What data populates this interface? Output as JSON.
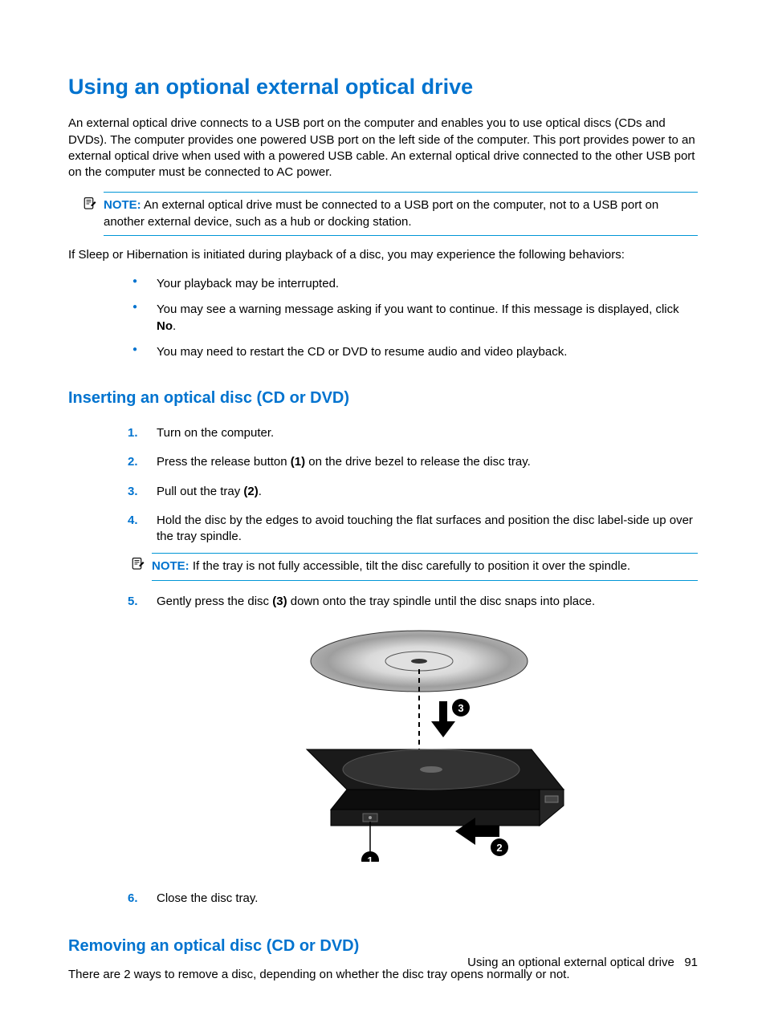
{
  "h1": "Using an optional external optical drive",
  "intro": "An external optical drive connects to a USB port on the computer and enables you to use optical discs (CDs and DVDs). The computer provides one powered USB port on the left side of the computer. This port provides power to an external optical drive when used with a powered USB cable. An external optical drive connected to the other USB port on the computer must be connected to AC power.",
  "note1_label": "NOTE:",
  "note1_text": "An external optical drive must be connected to a USB port on the computer, not to a USB port on another external device, such as a hub or docking station.",
  "sleep_intro": "If Sleep or Hibernation is initiated during playback of a disc, you may experience the following behaviors:",
  "bullet1": "Your playback may be interrupted.",
  "bullet2a": "You may see a warning message asking if you want to continue. If this message is displayed, click ",
  "bullet2b": "No",
  "bullet2c": ".",
  "bullet3": "You may need to restart the CD or DVD to resume audio and video playback.",
  "h2a": "Inserting an optical disc (CD or DVD)",
  "step1": "Turn on the computer.",
  "step2a": "Press the release button ",
  "step2b": "(1)",
  "step2c": " on the drive bezel to release the disc tray.",
  "step3a": "Pull out the tray ",
  "step3b": "(2)",
  "step3c": ".",
  "step4": "Hold the disc by the edges to avoid touching the flat surfaces and position the disc label-side up over the tray spindle.",
  "note2_label": "NOTE:",
  "note2_text": "If the tray is not fully accessible, tilt the disc carefully to position it over the spindle.",
  "step5a": "Gently press the disc ",
  "step5b": "(3)",
  "step5c": " down onto the tray spindle until the disc snaps into place.",
  "step6": "Close the disc tray.",
  "h2b": "Removing an optical disc (CD or DVD)",
  "removing_intro": "There are 2 ways to remove a disc, depending on whether the disc tray opens normally or not.",
  "footer_title": "Using an optional external optical drive",
  "footer_page": "91"
}
